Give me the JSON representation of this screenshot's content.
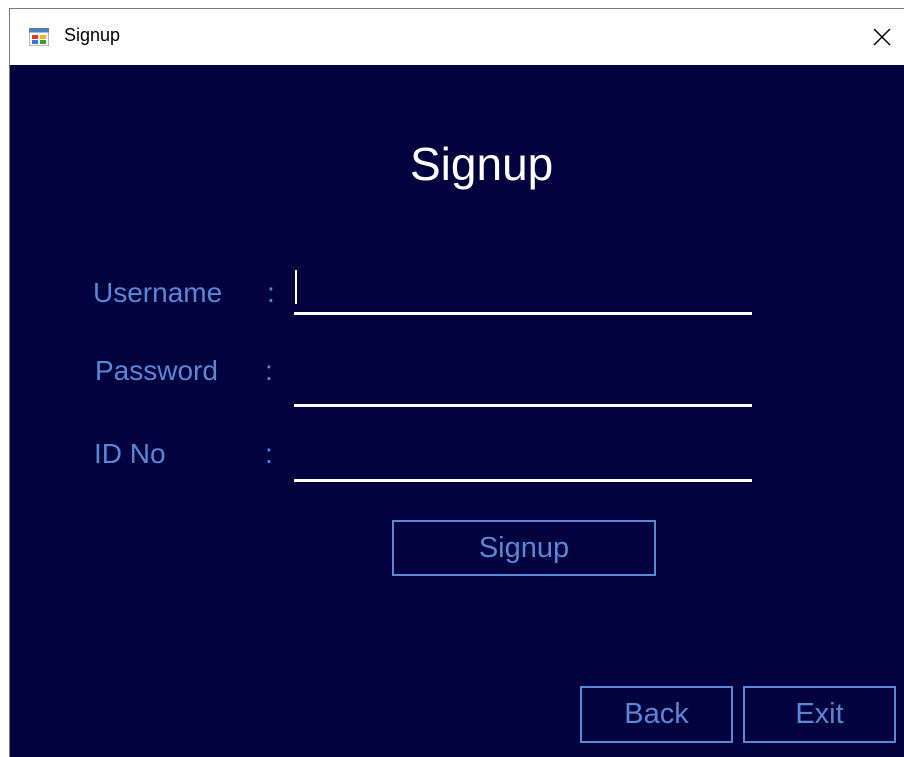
{
  "window": {
    "title": "Signup",
    "icon": "windows-form-icon",
    "close_icon": "close-icon"
  },
  "form": {
    "heading": "Signup",
    "fields": [
      {
        "label": "Username",
        "colon": ":",
        "value": ""
      },
      {
        "label": "Password",
        "colon": ":",
        "value": ""
      },
      {
        "label": "ID No",
        "colon": ":",
        "value": ""
      }
    ],
    "signup_button": "Signup"
  },
  "footer": {
    "back_button": "Back",
    "exit_button": "Exit"
  },
  "colors": {
    "background": "#02023e",
    "label": "#5b86d6",
    "heading": "#ffffff",
    "field_underline": "#ffffff"
  }
}
